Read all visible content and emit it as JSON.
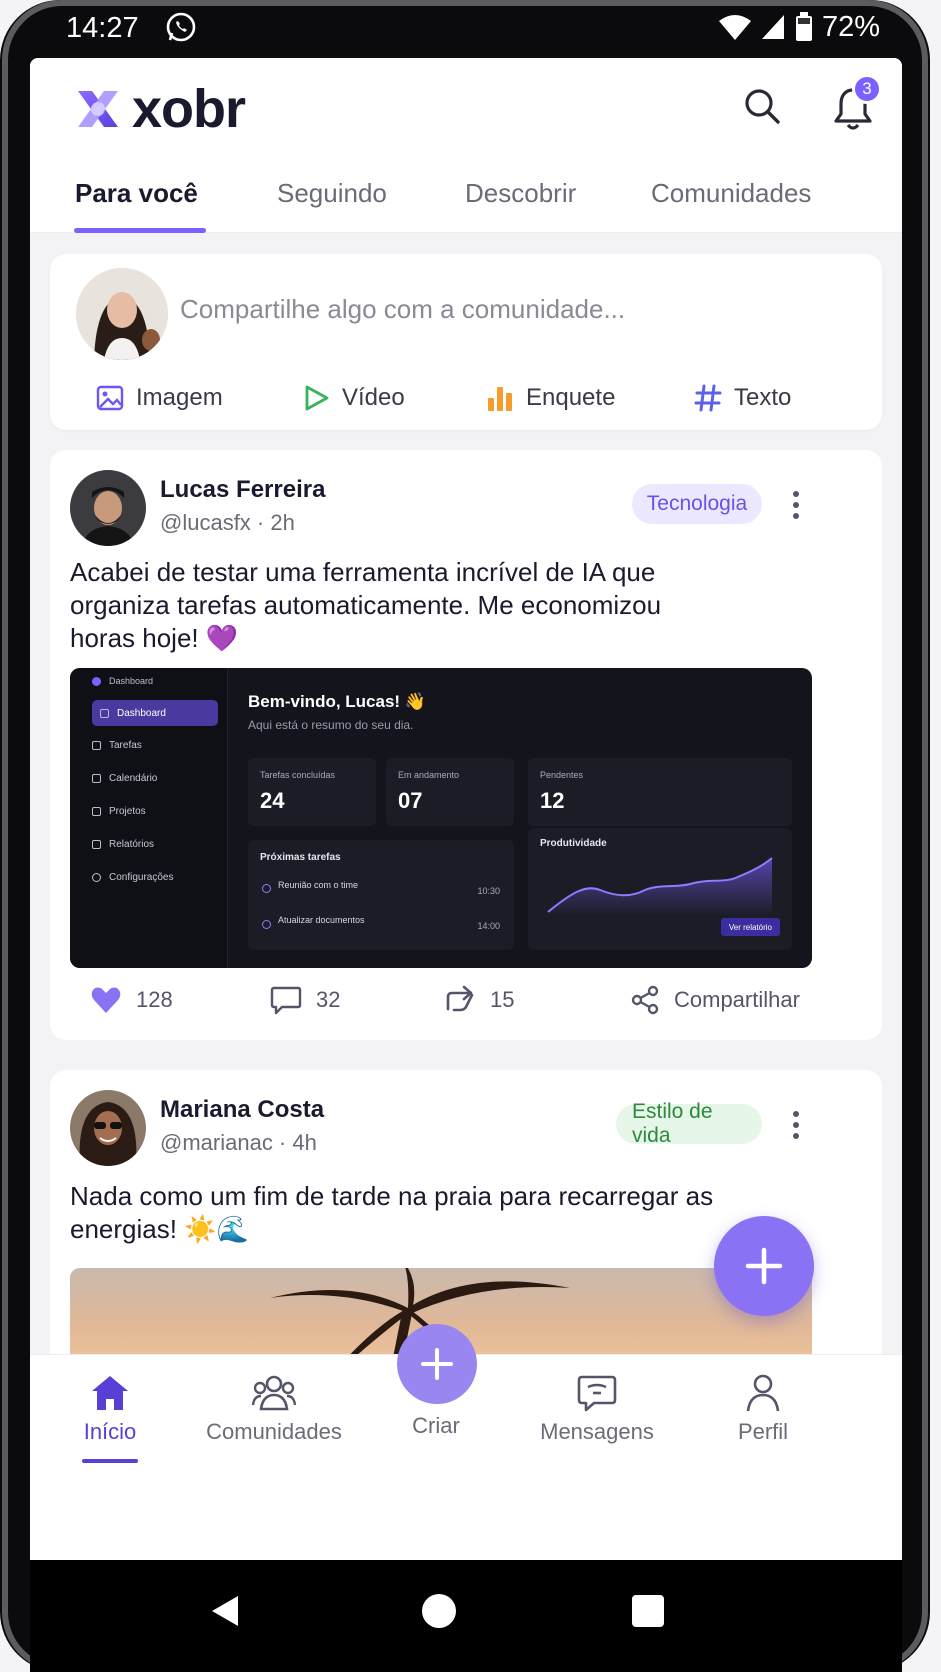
{
  "status_bar": {
    "time": "14:27",
    "battery": "72%"
  },
  "app": {
    "logo_text": "xobr",
    "notification_count": "3",
    "accent": "#7b61ff"
  },
  "tabs": [
    {
      "label": "Para você",
      "active": true
    },
    {
      "label": "Seguindo",
      "active": false
    },
    {
      "label": "Descobrir",
      "active": false
    },
    {
      "label": "Comunidades",
      "active": false
    }
  ],
  "composer": {
    "placeholder": "Compartilhe algo com a comunidade...",
    "actions": [
      {
        "label": "Imagem",
        "icon": "image-icon"
      },
      {
        "label": "Vídeo",
        "icon": "play-icon"
      },
      {
        "label": "Enquete",
        "icon": "bar-chart-icon"
      },
      {
        "label": "Texto",
        "icon": "hashtag-icon"
      }
    ]
  },
  "posts": [
    {
      "name": "Lucas Ferreira",
      "handle": "@lucasfx · 2h",
      "category": "Tecnologia",
      "text": "Acabei de testar uma ferramenta incrível de IA que organiza tarefas automaticamente. Me economizou horas hoje! 💜",
      "likes": "128",
      "comments": "32",
      "reposts": "15",
      "share_label": "Compartilhar",
      "image": {
        "sidebar_title": "Dashboard",
        "menu": [
          "Dashboard",
          "Tarefas",
          "Calendário",
          "Projetos",
          "Relatórios",
          "Configurações"
        ],
        "greeting": "Bem-vindo, Lucas! 👋",
        "subtitle": "Aqui está o resumo do seu dia.",
        "cards": [
          {
            "label": "Tarefas concluídas",
            "value": "24"
          },
          {
            "label": "Em andamento",
            "value": "07"
          },
          {
            "label": "Pendentes",
            "value": "12"
          }
        ],
        "tasks_title": "Próximas tarefas",
        "tasks": [
          {
            "title": "Reunião com o time",
            "time": "10:30"
          },
          {
            "title": "Atualizar documentos",
            "time": "14:00"
          }
        ],
        "chart_title": "Produtividade",
        "report_button": "Ver relatório"
      }
    },
    {
      "name": "Mariana Costa",
      "handle": "@marianac · 4h",
      "category": "Estilo de vida",
      "text": "Nada como um fim de tarde na praia para recarregar as energias! ☀️🌊"
    }
  ],
  "bottom_nav": [
    {
      "label": "Início",
      "icon": "home-icon",
      "active": true
    },
    {
      "label": "Comunidades",
      "icon": "people-icon",
      "active": false
    },
    {
      "label": "Criar",
      "icon": "plus-icon",
      "active": false
    },
    {
      "label": "Mensagens",
      "icon": "chat-icon",
      "active": false
    },
    {
      "label": "Perfil",
      "icon": "person-icon",
      "active": false
    }
  ]
}
